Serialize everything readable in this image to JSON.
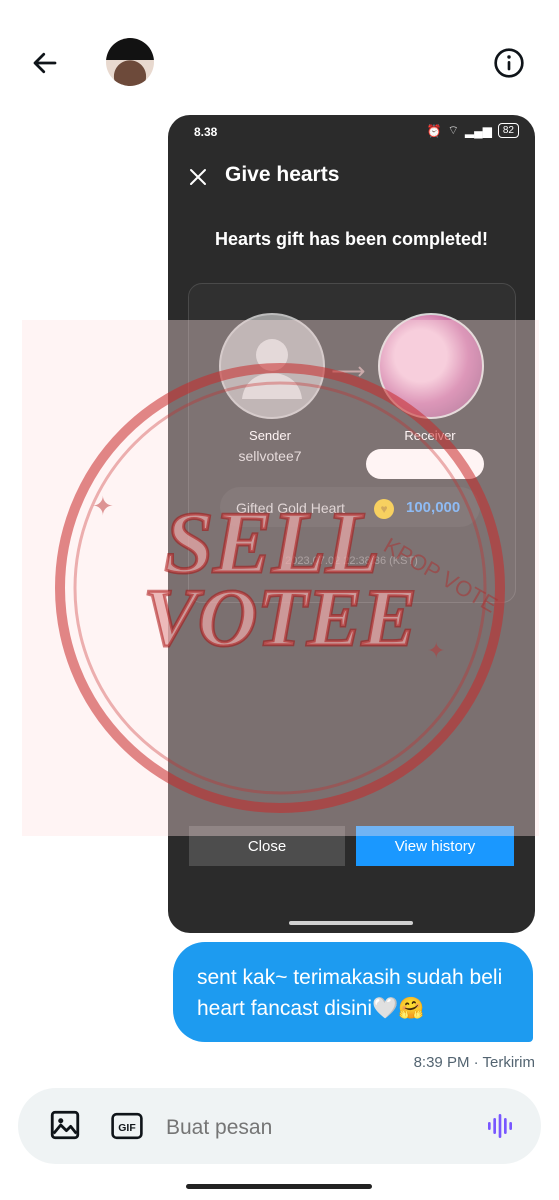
{
  "topbar": {
    "back_icon": "arrow-left-icon",
    "info_icon": "info-circle-icon"
  },
  "screenshot": {
    "status": {
      "time": "8.38",
      "battery": "82"
    },
    "header_title": "Give hearts",
    "completed_message": "Hearts gift has been completed!",
    "sender": {
      "label": "Sender",
      "name": "sellvotee7"
    },
    "receiver": {
      "label": "Receiver"
    },
    "gift": {
      "label": "Gifted Gold Heart",
      "amount": "100,000"
    },
    "timestamp": "2023.07.02 22:38:36 (KST)",
    "buttons": {
      "close": "Close",
      "history": "View history"
    }
  },
  "watermark": {
    "line1": "SELL",
    "line2": "VOTEE",
    "ring_text": "KPOP VOTE",
    "color": "#c92a2a"
  },
  "message": {
    "text": "sent kak~ terimakasih sudah beli heart fancast disini🤍🤗",
    "meta": "8:39 PM · Terkirim"
  },
  "composer": {
    "placeholder": "Buat pesan",
    "gif_label": "GIF"
  },
  "colors": {
    "accent": "#1d9bf0",
    "app_bg": "#2b2b2b",
    "button_blue": "#1a98ff"
  }
}
